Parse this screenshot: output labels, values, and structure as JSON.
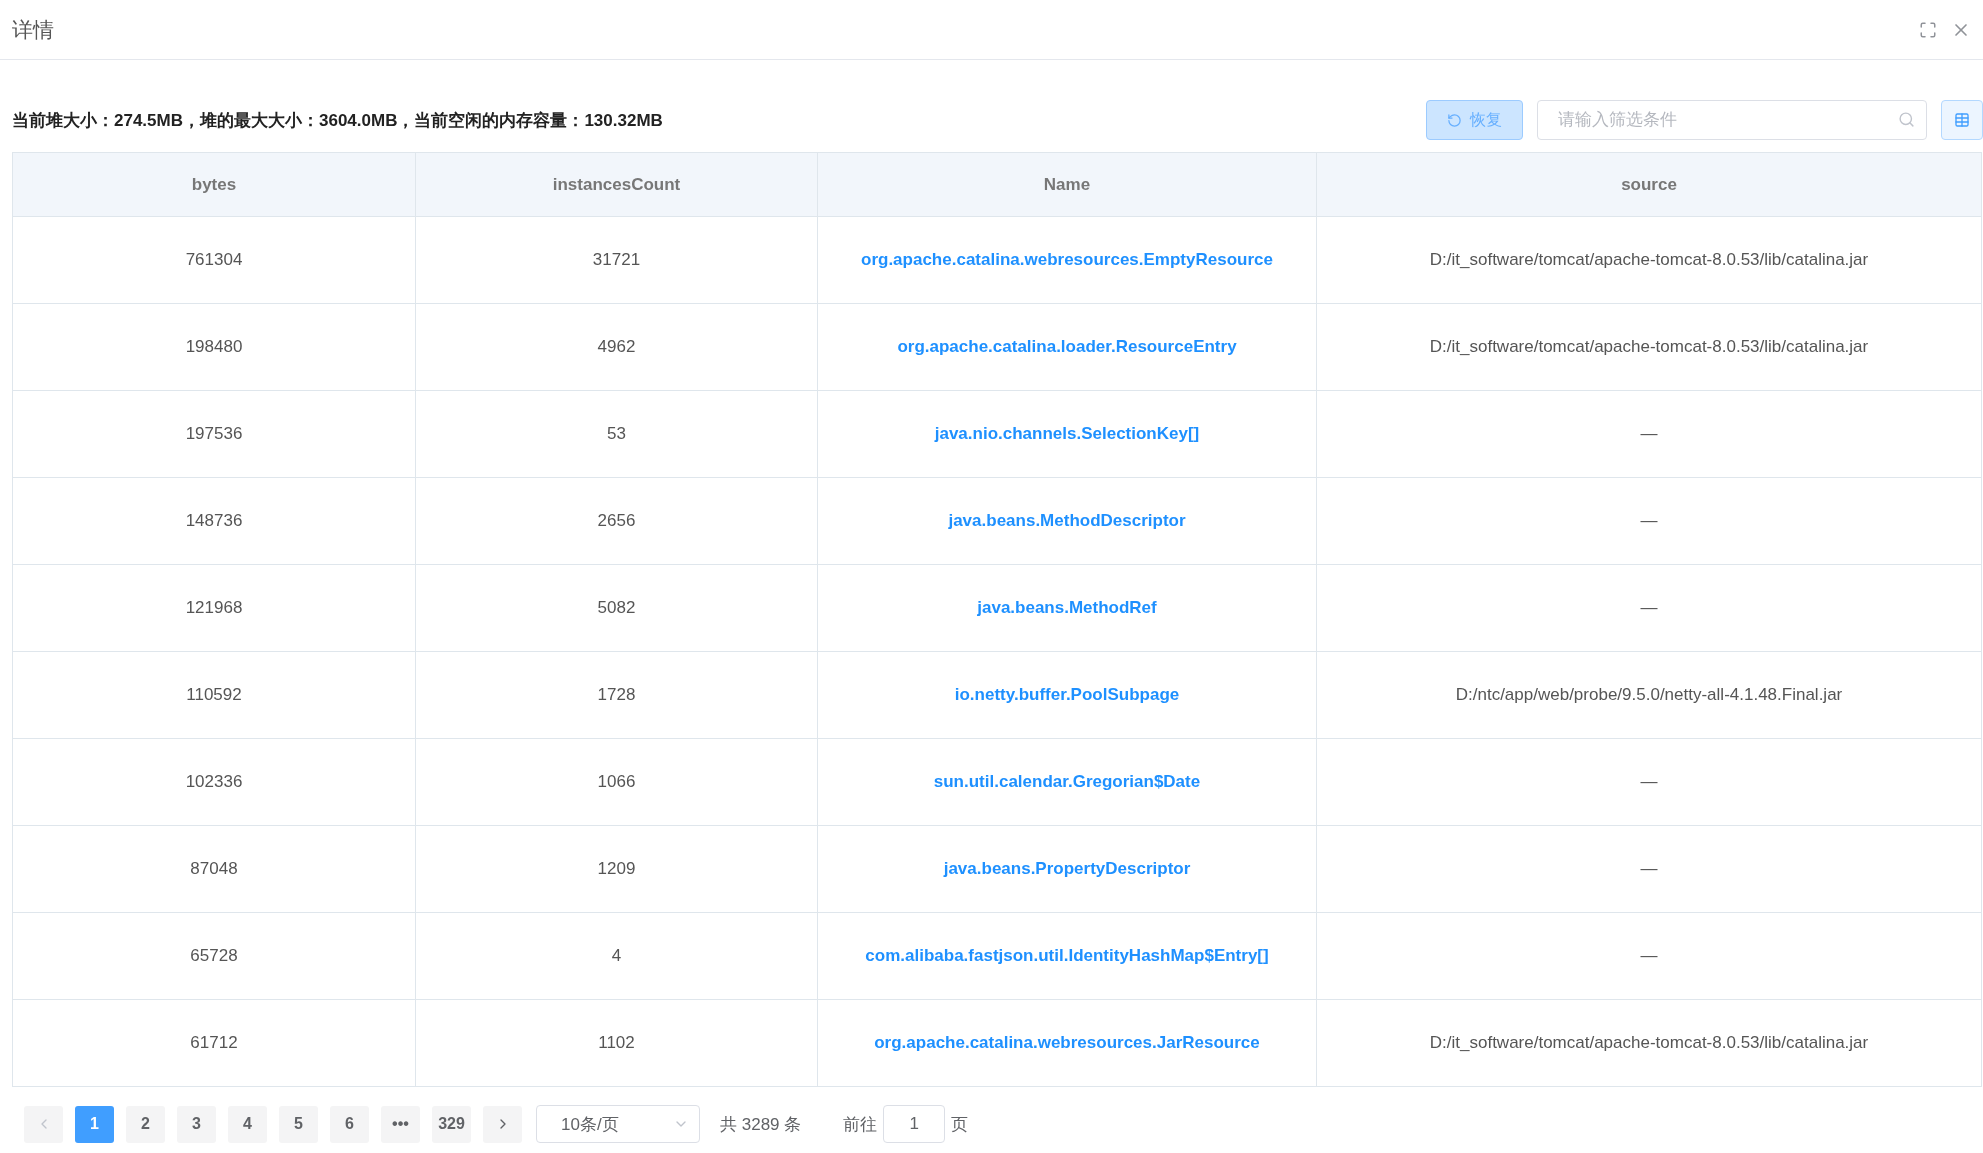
{
  "dialog": {
    "title": "详情"
  },
  "summary": "当前堆大小：274.5MB，堆的最大大小：3604.0MB，当前空闲的内存容量：130.32MB",
  "toolbar": {
    "restore_button": "恢复",
    "search": {
      "placeholder": "请输入筛选条件"
    }
  },
  "table": {
    "columns": [
      "bytes",
      "instancesCount",
      "Name",
      "source"
    ],
    "rows": [
      {
        "bytes": "761304",
        "instancesCount": "31721",
        "name": "org.apache.catalina.webresources.EmptyResource",
        "source": "D:/it_software/tomcat/apache-tomcat-8.0.53/lib/catalina.jar"
      },
      {
        "bytes": "198480",
        "instancesCount": "4962",
        "name": "org.apache.catalina.loader.ResourceEntry",
        "source": "D:/it_software/tomcat/apache-tomcat-8.0.53/lib/catalina.jar"
      },
      {
        "bytes": "197536",
        "instancesCount": "53",
        "name": "java.nio.channels.SelectionKey[]",
        "source": "—"
      },
      {
        "bytes": "148736",
        "instancesCount": "2656",
        "name": "java.beans.MethodDescriptor",
        "source": "—"
      },
      {
        "bytes": "121968",
        "instancesCount": "5082",
        "name": "java.beans.MethodRef",
        "source": "—"
      },
      {
        "bytes": "110592",
        "instancesCount": "1728",
        "name": "io.netty.buffer.PoolSubpage",
        "source": "D:/ntc/app/web/probe/9.5.0/netty-all-4.1.48.Final.jar"
      },
      {
        "bytes": "102336",
        "instancesCount": "1066",
        "name": "sun.util.calendar.Gregorian$Date",
        "source": "—"
      },
      {
        "bytes": "87048",
        "instancesCount": "1209",
        "name": "java.beans.PropertyDescriptor",
        "source": "—"
      },
      {
        "bytes": "65728",
        "instancesCount": "4",
        "name": "com.alibaba.fastjson.util.IdentityHashMap$Entry[]",
        "source": "—"
      },
      {
        "bytes": "61712",
        "instancesCount": "1102",
        "name": "org.apache.catalina.webresources.JarResource",
        "source": "D:/it_software/tomcat/apache-tomcat-8.0.53/lib/catalina.jar"
      }
    ]
  },
  "pagination": {
    "pages": [
      {
        "label": "1",
        "selected": true
      },
      {
        "label": "2",
        "selected": false
      },
      {
        "label": "3",
        "selected": false
      },
      {
        "label": "4",
        "selected": false
      },
      {
        "label": "5",
        "selected": false
      },
      {
        "label": "6",
        "selected": false
      },
      {
        "label": "•••",
        "selected": false
      },
      {
        "label": "329",
        "selected": false
      }
    ],
    "page_size": "10条/页",
    "total": "共 3289 条",
    "goto_label": "前往",
    "goto_value": "1",
    "goto_suffix": "页"
  }
}
